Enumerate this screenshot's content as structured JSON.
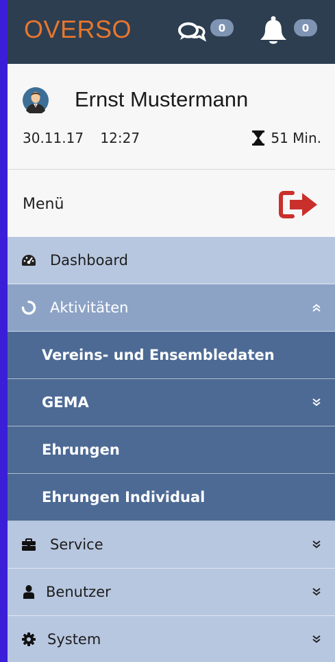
{
  "header": {
    "brand": "OVERSO",
    "messages_count": "0",
    "notifications_count": "0"
  },
  "user": {
    "name": "Ernst Mustermann",
    "date": "30.11.17",
    "time": "12:27",
    "session_remaining": "51 Min."
  },
  "menu": {
    "label": "Menü"
  },
  "nav": {
    "dashboard": "Dashboard",
    "aktivitaeten": "Aktivitäten",
    "sub": {
      "vereins": "Vereins- und Ensembledaten",
      "gema": "GEMA",
      "ehrungen": "Ehrungen",
      "ehrungen_individual": "Ehrungen Individual"
    },
    "service": "Service",
    "benutzer": "Benutzer",
    "system": "System"
  },
  "colors": {
    "header_bg": "#2c3e50",
    "brand": "#e8762e",
    "badge": "#7f94b3",
    "nav_light": "#b8c7e0",
    "nav_active": "#8ca3c6",
    "nav_sub": "#4d6a95",
    "logout": "#c9302c"
  }
}
